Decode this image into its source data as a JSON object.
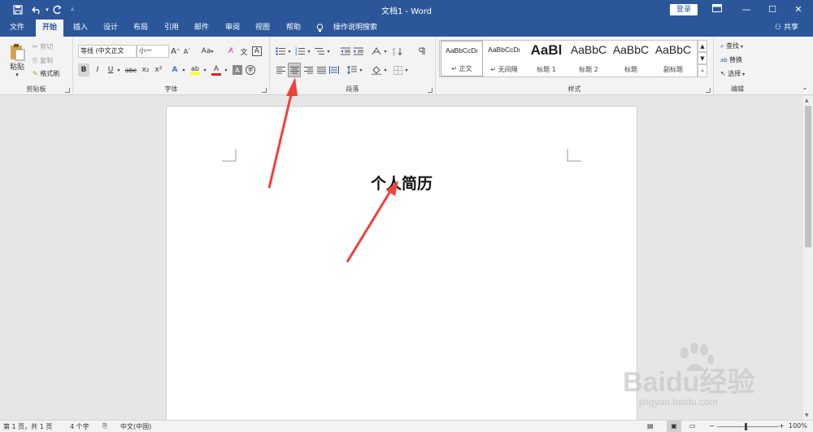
{
  "titlebar": {
    "title": "文档1 - Word",
    "login": "登录",
    "restore_icon": "ribbon-display-icon",
    "minimize": "—",
    "maximize": "☐",
    "close": "✕"
  },
  "tabs": [
    "文件",
    "开始",
    "插入",
    "设计",
    "布局",
    "引用",
    "邮件",
    "审阅",
    "视图",
    "帮助"
  ],
  "tell_me": "操作说明搜索",
  "share": "共享",
  "clipboard": {
    "paste": "粘贴",
    "cut": "剪切",
    "copy": "复制",
    "format_painter": "格式刷",
    "label": "剪贴板"
  },
  "font": {
    "name": "等线 (中文正文",
    "size": "小一",
    "label": "字体",
    "change_case": "Aa",
    "phonetic": "文",
    "border_char": "A",
    "bold": "B",
    "italic": "I",
    "underline": "U",
    "strike": "abc",
    "subscript": "x₂",
    "superscript": "x²",
    "grow": "A",
    "shrink": "A",
    "encircle": "字"
  },
  "paragraph": {
    "label": "段落"
  },
  "styles": {
    "label": "样式",
    "items": [
      {
        "sample": "AaBbCcDı",
        "name": "↵ 正文"
      },
      {
        "sample": "AaBbCcDı",
        "name": "↵ 无间隔"
      },
      {
        "sample": "AaBl",
        "name": "标题 1"
      },
      {
        "sample": "AaBbC",
        "name": "标题 2"
      },
      {
        "sample": "AaBbC",
        "name": "标题"
      },
      {
        "sample": "AaBbC",
        "name": "副标题"
      }
    ]
  },
  "editing": {
    "label": "编辑",
    "find": "查找",
    "replace": "替换",
    "select": "选择"
  },
  "document": {
    "heading": "个人简历"
  },
  "status": {
    "page": "第 1 页，共 1 页",
    "words": "4 个字",
    "language": "中文(中国)",
    "zoom": "100%"
  },
  "watermark": {
    "brand": "Baidu经验",
    "url": "jingyan.baidu.com"
  },
  "colors": {
    "accent": "#2b579a",
    "arrow": "#f0413a",
    "highlight": "#ffff00",
    "font_color": "#e02020"
  }
}
